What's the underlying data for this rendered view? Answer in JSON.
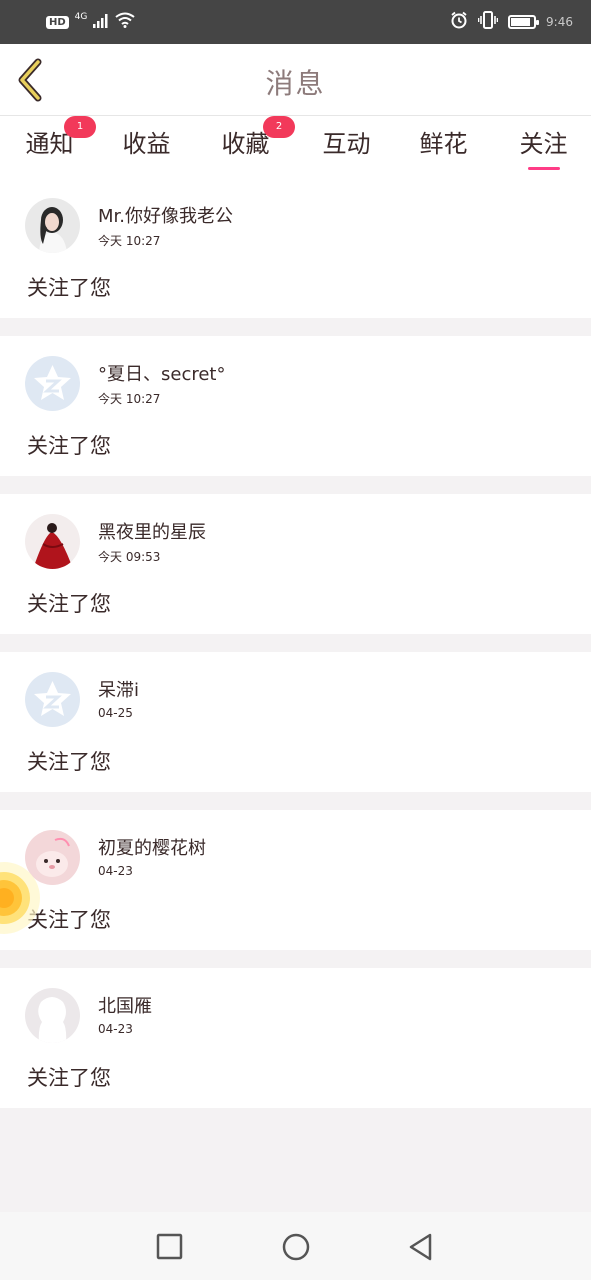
{
  "status_bar": {
    "hd": "HD",
    "network": "4G",
    "time": "9:46",
    "battery_level": 0.85
  },
  "header": {
    "title": "消息",
    "back_icon": "chevron-left-icon"
  },
  "tabs": [
    {
      "label": "通知",
      "badge": "1"
    },
    {
      "label": "收益",
      "badge": ""
    },
    {
      "label": "收藏",
      "badge": "2"
    },
    {
      "label": "互动",
      "badge": ""
    },
    {
      "label": "鲜花",
      "badge": ""
    },
    {
      "label": "关注",
      "badge": "",
      "active": true
    }
  ],
  "follows": [
    {
      "name": "Mr.你好像我老公",
      "time": "今天 10:27",
      "action": "关注了您",
      "avatar": "photo-girl"
    },
    {
      "name": "°夏日、secret°",
      "time": "今天 10:27",
      "action": "关注了您",
      "avatar": "default-z"
    },
    {
      "name": "黑夜里的星辰",
      "time": "今天 09:53",
      "action": "关注了您",
      "avatar": "photo-red-dress"
    },
    {
      "name": "呆滞i",
      "time": "04-25",
      "action": "关注了您",
      "avatar": "default-z"
    },
    {
      "name": "初夏的樱花树",
      "time": "04-23",
      "action": "关注了您",
      "avatar": "photo-cute"
    },
    {
      "name": "北国雁",
      "time": "04-23",
      "action": "关注了您",
      "avatar": "default-silhouette"
    }
  ],
  "colors": {
    "accent": "#ff3c86",
    "badge": "#f2395a",
    "back_arrow": "#d8b94a",
    "default_avatar": "#dfe8f3"
  },
  "nav": {
    "recent_icon": "square-icon",
    "home_icon": "circle-icon",
    "back_icon": "triangle-back-icon"
  }
}
